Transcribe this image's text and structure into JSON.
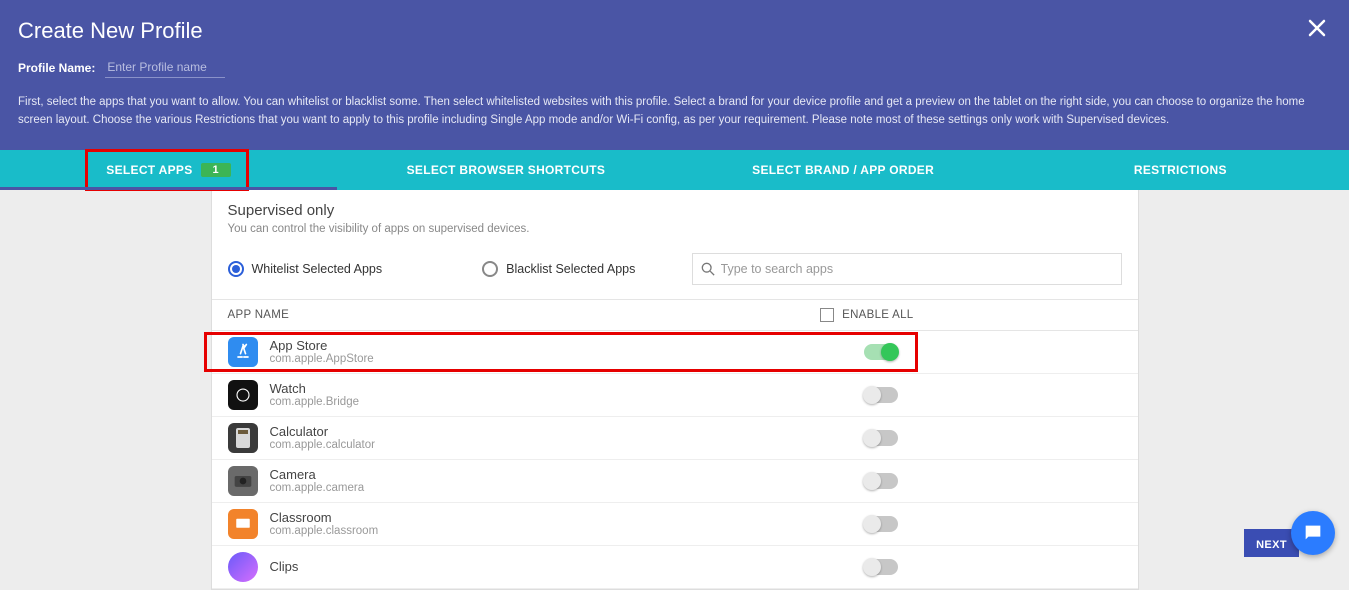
{
  "header": {
    "title": "Create New Profile",
    "profileNameLabel": "Profile Name:",
    "profileNamePlaceholder": "Enter Profile name",
    "description": "First, select the apps that you want to allow. You can whitelist or blacklist some. Then select whitelisted websites with this profile. Select a brand for your device profile and get a preview on the tablet on the right side, you can choose to organize the home screen layout. Choose the various Restrictions that you want to apply to this profile including Single App mode and/or Wi-Fi config, as per your requirement. Please note most of these settings only work with Supervised devices."
  },
  "tabs": {
    "selectApps": "SELECT APPS",
    "selectAppsBadge": "1",
    "browserShortcuts": "SELECT BROWSER SHORTCUTS",
    "brandOrder": "SELECT BRAND / APP ORDER",
    "restrictions": "RESTRICTIONS"
  },
  "panel": {
    "title": "Supervised only",
    "subtitle": "You can control the visibility of apps on supervised devices.",
    "whitelistLabel": "Whitelist Selected Apps",
    "blacklistLabel": "Blacklist Selected Apps",
    "searchPlaceholder": "Type to search apps",
    "appNameHeader": "APP NAME",
    "enableAllLabel": "ENABLE ALL"
  },
  "apps": [
    {
      "name": "App Store",
      "id": "com.apple.AppStore",
      "enabled": true,
      "highlight": true,
      "iconClass": "ic-appstore"
    },
    {
      "name": "Watch",
      "id": "com.apple.Bridge",
      "enabled": false,
      "highlight": false,
      "iconClass": "ic-watch"
    },
    {
      "name": "Calculator",
      "id": "com.apple.calculator",
      "enabled": false,
      "highlight": false,
      "iconClass": "ic-calc"
    },
    {
      "name": "Camera",
      "id": "com.apple.camera",
      "enabled": false,
      "highlight": false,
      "iconClass": "ic-camera"
    },
    {
      "name": "Classroom",
      "id": "com.apple.classroom",
      "enabled": false,
      "highlight": false,
      "iconClass": "ic-classroom"
    },
    {
      "name": "Clips",
      "id": "",
      "enabled": false,
      "highlight": false,
      "iconClass": "ic-clips"
    }
  ],
  "footer": {
    "nextLabel": "NEXT"
  }
}
